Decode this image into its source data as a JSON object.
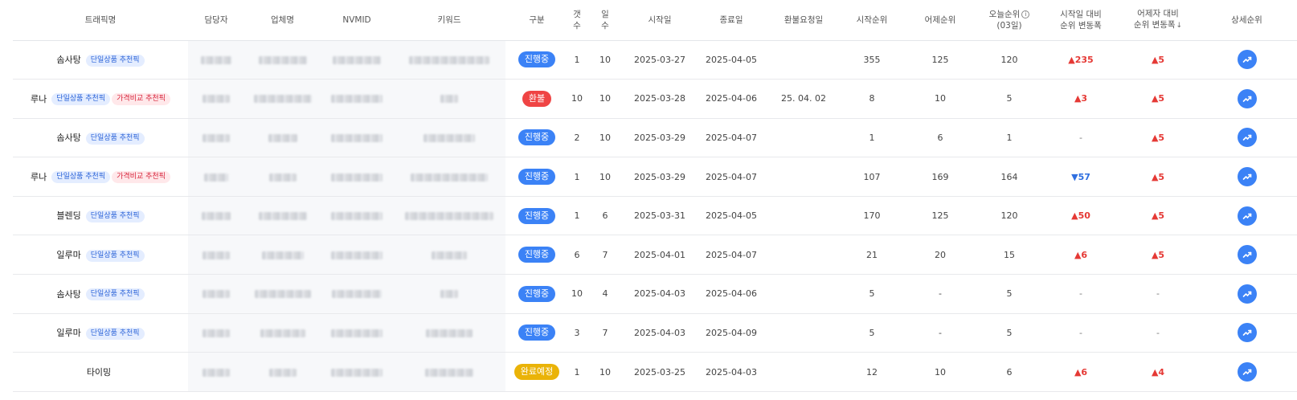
{
  "headers": {
    "traffic": "트래픽명",
    "manager": "담당자",
    "company": "업체명",
    "nvmid": "NVMID",
    "keyword": "키워드",
    "type": "구분",
    "count_l1": "갯",
    "count_l2": "수",
    "days_l1": "일",
    "days_l2": "수",
    "start": "시작일",
    "end": "종료일",
    "refund_date": "환불요청일",
    "start_rank": "시작순위",
    "yesterday_rank": "어제순위",
    "today_rank_l1": "오늘순위",
    "today_rank_l2": "(03일)",
    "change_start_l1": "시작일 대비",
    "change_start_l2": "순위 변동폭",
    "change_yest_l1": "어제자 대비",
    "change_yest_l2": "순위 변동폭",
    "detail": "상세순위"
  },
  "tags": {
    "single": "단일상품 추천픽",
    "compare": "가격비교 추천픽"
  },
  "rows": [
    {
      "traffic": "솜사탕",
      "tags": [
        "single"
      ],
      "status": "진행중",
      "status_kind": "progress",
      "count": "1",
      "days": "10",
      "start": "2025-03-27",
      "end": "2025-04-05",
      "refund": "",
      "start_rank": "355",
      "yest_rank": "125",
      "today_rank": "120",
      "chg_start": "▲235",
      "chg_start_dir": "up",
      "chg_yest": "▲5",
      "chg_yest_dir": "up",
      "blur": [
        38,
        60,
        60,
        100
      ]
    },
    {
      "traffic": "루나",
      "tags": [
        "single",
        "compare"
      ],
      "status": "환불",
      "status_kind": "refund",
      "count": "10",
      "days": "10",
      "start": "2025-03-28",
      "end": "2025-04-06",
      "refund": "25. 04. 02",
      "start_rank": "8",
      "yest_rank": "10",
      "today_rank": "5",
      "chg_start": "▲3",
      "chg_start_dir": "up",
      "chg_yest": "▲5",
      "chg_yest_dir": "up",
      "blur": [
        34,
        72,
        64,
        22
      ]
    },
    {
      "traffic": "솜사탕",
      "tags": [
        "single"
      ],
      "status": "진행중",
      "status_kind": "progress",
      "count": "2",
      "days": "10",
      "start": "2025-03-29",
      "end": "2025-04-07",
      "refund": "",
      "start_rank": "1",
      "yest_rank": "6",
      "today_rank": "1",
      "chg_start": "-",
      "chg_start_dir": "flat",
      "chg_yest": "▲5",
      "chg_yest_dir": "up",
      "blur": [
        34,
        36,
        64,
        64
      ]
    },
    {
      "traffic": "루나",
      "tags": [
        "single",
        "compare"
      ],
      "status": "진행중",
      "status_kind": "progress",
      "count": "1",
      "days": "10",
      "start": "2025-03-29",
      "end": "2025-04-07",
      "refund": "",
      "start_rank": "107",
      "yest_rank": "169",
      "today_rank": "164",
      "chg_start": "▼57",
      "chg_start_dir": "down",
      "chg_yest": "▲5",
      "chg_yest_dir": "up",
      "blur": [
        30,
        34,
        64,
        96
      ]
    },
    {
      "traffic": "블렌딩",
      "tags": [
        "single"
      ],
      "status": "진행중",
      "status_kind": "progress",
      "count": "1",
      "days": "6",
      "start": "2025-03-31",
      "end": "2025-04-05",
      "refund": "",
      "start_rank": "170",
      "yest_rank": "125",
      "today_rank": "120",
      "chg_start": "▲50",
      "chg_start_dir": "up",
      "chg_yest": "▲5",
      "chg_yest_dir": "up",
      "blur": [
        36,
        60,
        64,
        110
      ]
    },
    {
      "traffic": "일루마",
      "tags": [
        "single"
      ],
      "status": "진행중",
      "status_kind": "progress",
      "count": "6",
      "days": "7",
      "start": "2025-04-01",
      "end": "2025-04-07",
      "refund": "",
      "start_rank": "21",
      "yest_rank": "20",
      "today_rank": "15",
      "chg_start": "▲6",
      "chg_start_dir": "up",
      "chg_yest": "▲5",
      "chg_yest_dir": "up",
      "blur": [
        34,
        52,
        64,
        44
      ]
    },
    {
      "traffic": "솜사탕",
      "tags": [
        "single"
      ],
      "status": "진행중",
      "status_kind": "progress",
      "count": "10",
      "days": "4",
      "start": "2025-04-03",
      "end": "2025-04-06",
      "refund": "",
      "start_rank": "5",
      "yest_rank": "-",
      "today_rank": "5",
      "chg_start": "-",
      "chg_start_dir": "flat",
      "chg_yest": "-",
      "chg_yest_dir": "flat",
      "blur": [
        34,
        70,
        62,
        22
      ]
    },
    {
      "traffic": "일루마",
      "tags": [
        "single"
      ],
      "status": "진행중",
      "status_kind": "progress",
      "count": "3",
      "days": "7",
      "start": "2025-04-03",
      "end": "2025-04-09",
      "refund": "",
      "start_rank": "5",
      "yest_rank": "-",
      "today_rank": "5",
      "chg_start": "-",
      "chg_start_dir": "flat",
      "chg_yest": "-",
      "chg_yest_dir": "flat",
      "blur": [
        34,
        56,
        64,
        58
      ]
    },
    {
      "traffic": "타이밍",
      "tags": [],
      "status": "완료예정",
      "status_kind": "done",
      "count": "1",
      "days": "10",
      "start": "2025-03-25",
      "end": "2025-04-03",
      "refund": "",
      "start_rank": "12",
      "yest_rank": "10",
      "today_rank": "6",
      "chg_start": "▲6",
      "chg_start_dir": "up",
      "chg_yest": "▲4",
      "chg_yest_dir": "up",
      "blur": [
        34,
        34,
        64,
        60
      ]
    }
  ]
}
